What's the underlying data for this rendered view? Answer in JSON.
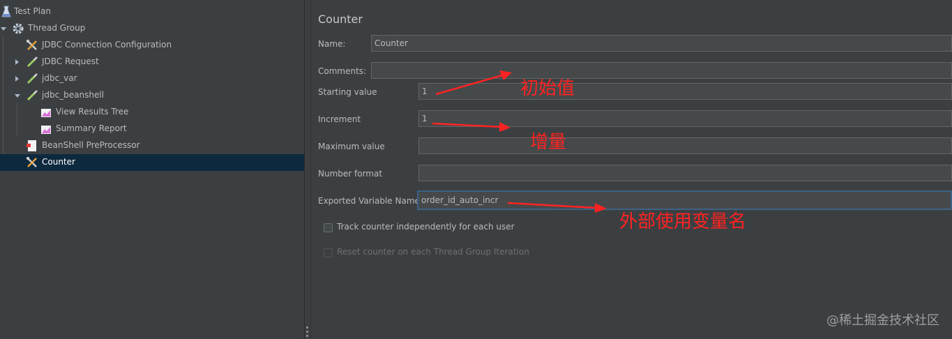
{
  "tree": {
    "items": [
      {
        "label": "Test Plan",
        "icon": "test-plan-icon"
      },
      {
        "label": "Thread Group",
        "icon": "gear-icon"
      },
      {
        "label": "JDBC Connection Configuration",
        "icon": "wrench-screwdriver-icon"
      },
      {
        "label": "JDBC Request",
        "icon": "pipette-icon"
      },
      {
        "label": "jdbc_var",
        "icon": "pipette-icon"
      },
      {
        "label": "jdbc_beanshell",
        "icon": "pipette-icon"
      },
      {
        "label": "View Results Tree",
        "icon": "chart-icon"
      },
      {
        "label": "Summary Report",
        "icon": "chart-icon"
      },
      {
        "label": "BeanShell PreProcessor",
        "icon": "document-icon"
      },
      {
        "label": "Counter",
        "icon": "wrench-screwdriver-icon"
      }
    ],
    "selected": "Counter"
  },
  "panel": {
    "title": "Counter",
    "fields": {
      "name": {
        "label": "Name:",
        "value": "Counter"
      },
      "comments": {
        "label": "Comments:",
        "value": ""
      },
      "starting_value": {
        "label": "Starting value",
        "value": "1"
      },
      "increment": {
        "label": "Increment",
        "value": "1"
      },
      "maximum_value": {
        "label": "Maximum value",
        "value": ""
      },
      "number_format": {
        "label": "Number format",
        "value": ""
      },
      "exported_variable_name": {
        "label": "Exported Variable Name",
        "value": "order_id_auto_incr"
      }
    },
    "checkboxes": {
      "track_independently": {
        "label": "Track counter independently for each user",
        "checked": false,
        "enabled": true
      },
      "reset_on_iteration": {
        "label": "Reset counter on each Thread Group Iteration",
        "checked": false,
        "enabled": false
      }
    }
  },
  "annotations": {
    "initial_value": "初始值",
    "increment": "增量",
    "external_variable_name": "外部使用变量名",
    "color": "#ff2222"
  },
  "watermark": "@稀土掘金技术社区",
  "colors": {
    "background": "#3c3f41",
    "selection": "#0d293e",
    "field_background": "#45494a",
    "focus_border": "#3d6185"
  }
}
